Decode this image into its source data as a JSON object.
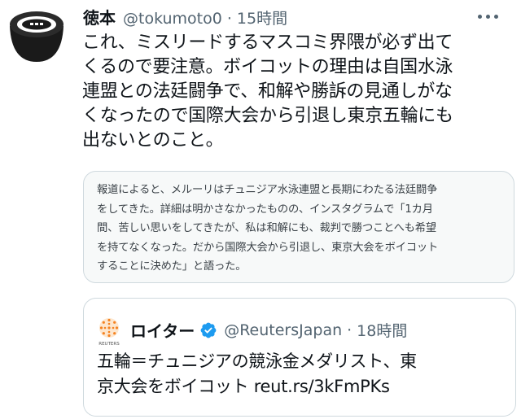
{
  "tweet": {
    "author_name": "徳本",
    "handle": "@tokumoto0",
    "separator": "·",
    "time": "15時間",
    "body_lines": [
      "これ、ミスリードするマスコミ界隈が必ず出て",
      "くるので要注意。ボイコットの理由は自国水泳",
      "連盟との法廷闘争で、和解や勝訴の見通しがな",
      "くなったので国際大会から引退し東京五輪にも",
      "出ないとのこと。"
    ],
    "more_icon": "more-horizontal-icon"
  },
  "quote_excerpt": {
    "lines": [
      "報道によると、メルーリはチュニジア水泳連盟と長期にわたる法廷闘争",
      "をしてきた。詳細は明かさなかったものの、インスタグラムで「1カ月",
      "間、苦しい思いをしてきたが、私は和解にも、裁判で勝つことへも希望",
      "を持てなくなった。だから国際大会から引退し、東京大会をボイコット",
      "することに決めた」と語った。"
    ]
  },
  "quoted_tweet": {
    "logo_text": "REUTERS",
    "author_name": "ロイター",
    "verified_icon": "verified-badge-icon",
    "handle": "@ReutersJapan",
    "separator": "·",
    "time": "18時間",
    "text_line1": "五輪＝チュニジアの競泳金メダリスト、東",
    "text_line2": "京大会をボイコット ",
    "link": "reut.rs/3kFmPKs"
  },
  "colors": {
    "text": "#0f1419",
    "secondary": "#536471",
    "border": "#cfd9de",
    "verified": "#1d9bf0",
    "reuters_orange": "#f58220"
  }
}
